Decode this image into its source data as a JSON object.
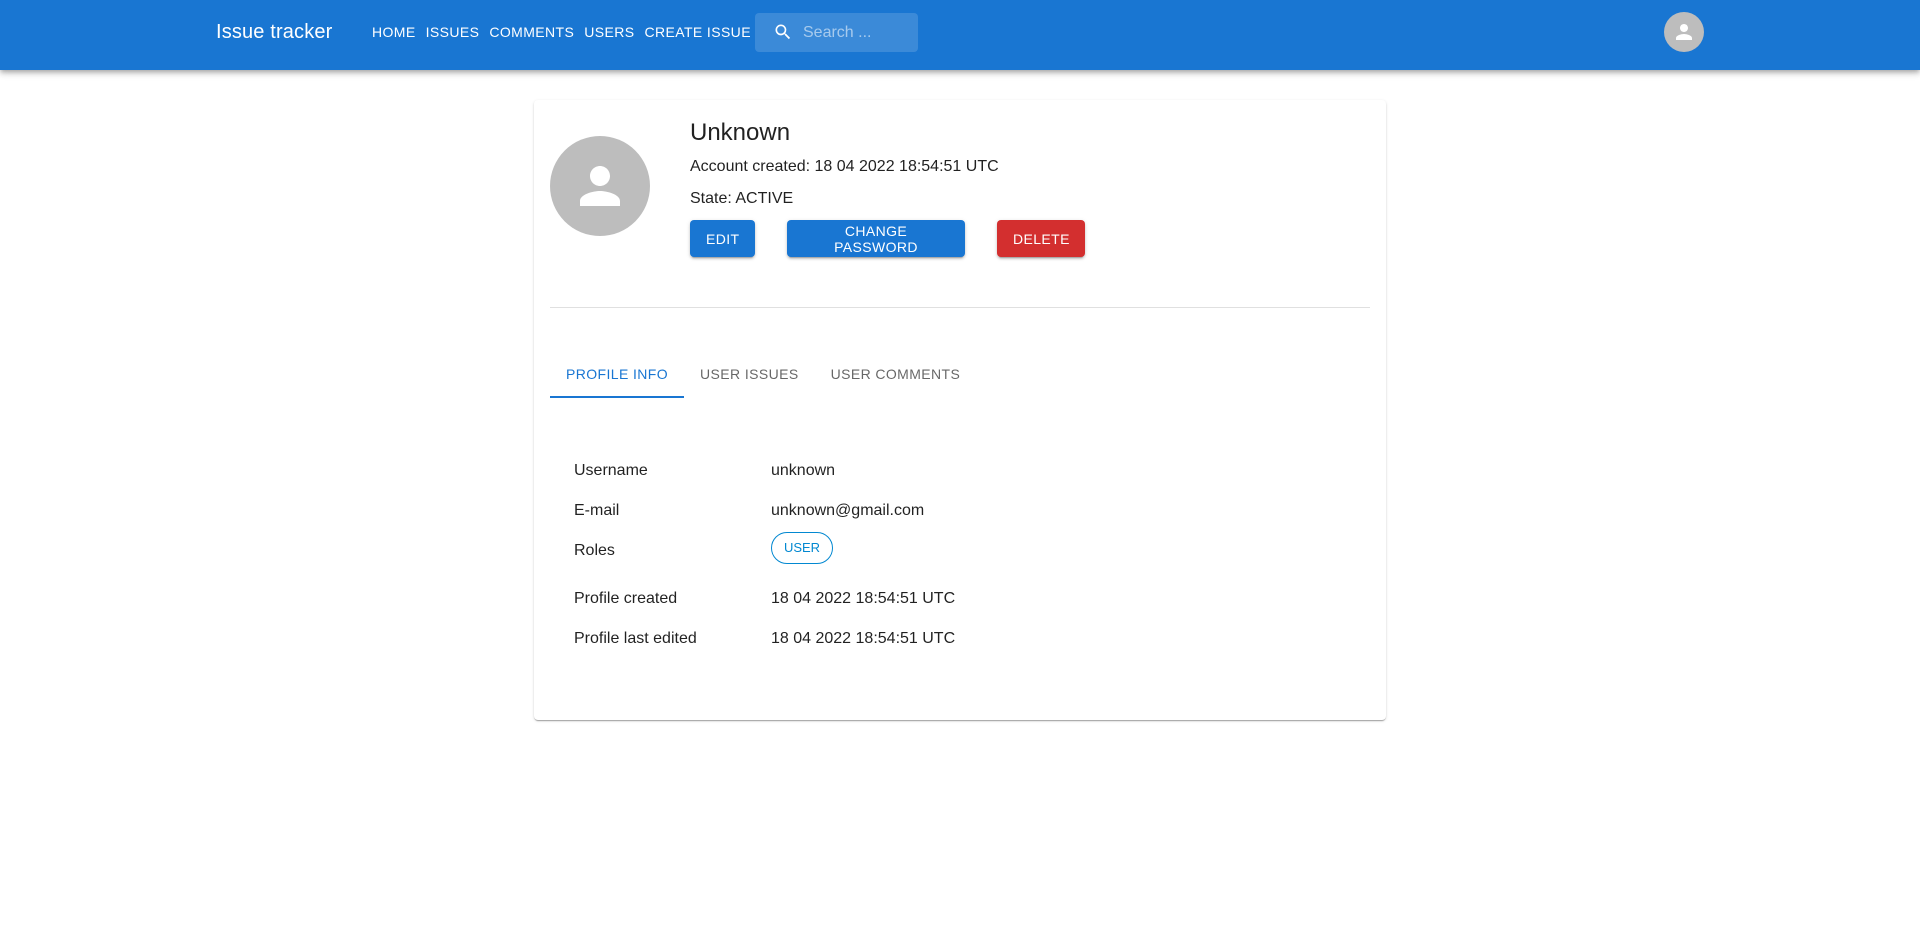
{
  "app": {
    "title": "Issue tracker"
  },
  "nav": {
    "home": "HOME",
    "issues": "ISSUES",
    "comments": "COMMENTS",
    "users": "USERS",
    "create_issue": "CREATE ISSUE"
  },
  "search": {
    "placeholder": "Search ...",
    "icon": "search-icon"
  },
  "header_avatar": {
    "icon": "person-icon",
    "color": "#bdbdbd"
  },
  "profile": {
    "name": "Unknown",
    "account_created": "Account created: 18 04 2022 18:54:51 UTC",
    "state": "State: ACTIVE"
  },
  "actions": {
    "edit": "EDIT",
    "change_password": "CHANGE PASSWORD",
    "delete": "DELETE"
  },
  "tabs": [
    {
      "label": "PROFILE INFO",
      "active": true
    },
    {
      "label": "USER ISSUES",
      "active": false
    },
    {
      "label": "USER COMMENTS",
      "active": false
    }
  ],
  "info": {
    "username_label": "Username",
    "username_value": "unknown",
    "email_label": "E-mail",
    "email_value": "unknown@gmail.com",
    "roles_label": "Roles",
    "roles": [
      "USER"
    ],
    "created_label": "Profile created",
    "created_value": "18 04 2022 18:54:51 UTC",
    "edited_label": "Profile last edited",
    "edited_value": "18 04 2022 18:54:51 UTC"
  },
  "colors": {
    "primary": "#1976d2",
    "danger": "#d32f2f",
    "chip": "#0288d1"
  }
}
